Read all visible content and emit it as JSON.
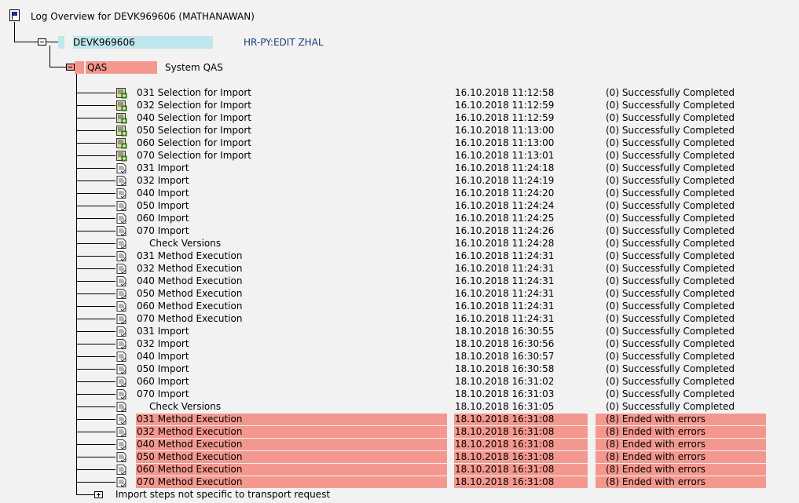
{
  "tree": {
    "root_title": "Log Overview for DEVK969606 (MATHANAWAN)",
    "system_node": {
      "label": "DEVK969606",
      "description": "HR-PY:EDIT ZHAL"
    },
    "target_node": {
      "label": "QAS",
      "description": "System QAS"
    },
    "footer_node": "Import steps not specific to transport request"
  },
  "colors": {
    "error_highlight": "#f4988f",
    "system_highlight": "#bfe6ec",
    "link": "#1a3c7a"
  },
  "rows": [
    {
      "icon": "selection-icon",
      "step": "031 Selection for Import",
      "date": "16.10.2018 11:12:58",
      "status": "(0) Successfully Completed",
      "error": false,
      "indent": false
    },
    {
      "icon": "selection-icon",
      "step": "032 Selection for Import",
      "date": "16.10.2018 11:12:59",
      "status": "(0) Successfully Completed",
      "error": false,
      "indent": false
    },
    {
      "icon": "selection-icon",
      "step": "040 Selection for Import",
      "date": "16.10.2018 11:12:59",
      "status": "(0) Successfully Completed",
      "error": false,
      "indent": false
    },
    {
      "icon": "selection-icon",
      "step": "050 Selection for Import",
      "date": "16.10.2018 11:13:00",
      "status": "(0) Successfully Completed",
      "error": false,
      "indent": false
    },
    {
      "icon": "selection-icon",
      "step": "060 Selection for Import",
      "date": "16.10.2018 11:13:00",
      "status": "(0) Successfully Completed",
      "error": false,
      "indent": false
    },
    {
      "icon": "selection-icon",
      "step": "070 Selection for Import",
      "date": "16.10.2018 11:13:01",
      "status": "(0) Successfully Completed",
      "error": false,
      "indent": false
    },
    {
      "icon": "document-icon",
      "step": "031 Import",
      "date": "16.10.2018 11:24:18",
      "status": "(0) Successfully Completed",
      "error": false,
      "indent": false
    },
    {
      "icon": "document-icon",
      "step": "032 Import",
      "date": "16.10.2018 11:24:19",
      "status": "(0) Successfully Completed",
      "error": false,
      "indent": false
    },
    {
      "icon": "document-icon",
      "step": "040 Import",
      "date": "16.10.2018 11:24:20",
      "status": "(0) Successfully Completed",
      "error": false,
      "indent": false
    },
    {
      "icon": "document-icon",
      "step": "050 Import",
      "date": "16.10.2018 11:24:24",
      "status": "(0) Successfully Completed",
      "error": false,
      "indent": false
    },
    {
      "icon": "document-icon",
      "step": "060 Import",
      "date": "16.10.2018 11:24:25",
      "status": "(0) Successfully Completed",
      "error": false,
      "indent": false
    },
    {
      "icon": "document-icon",
      "step": "070 Import",
      "date": "16.10.2018 11:24:26",
      "status": "(0) Successfully Completed",
      "error": false,
      "indent": false
    },
    {
      "icon": "document-icon",
      "step": "Check Versions",
      "date": "16.10.2018 11:24:28",
      "status": "(0) Successfully Completed",
      "error": false,
      "indent": true
    },
    {
      "icon": "document-icon",
      "step": "031 Method Execution",
      "date": "16.10.2018 11:24:31",
      "status": "(0) Successfully Completed",
      "error": false,
      "indent": false
    },
    {
      "icon": "document-icon",
      "step": "032 Method Execution",
      "date": "16.10.2018 11:24:31",
      "status": "(0) Successfully Completed",
      "error": false,
      "indent": false
    },
    {
      "icon": "document-icon",
      "step": "040 Method Execution",
      "date": "16.10.2018 11:24:31",
      "status": "(0) Successfully Completed",
      "error": false,
      "indent": false
    },
    {
      "icon": "document-icon",
      "step": "050 Method Execution",
      "date": "16.10.2018 11:24:31",
      "status": "(0) Successfully Completed",
      "error": false,
      "indent": false
    },
    {
      "icon": "document-icon",
      "step": "060 Method Execution",
      "date": "16.10.2018 11:24:31",
      "status": "(0) Successfully Completed",
      "error": false,
      "indent": false
    },
    {
      "icon": "document-icon",
      "step": "070 Method Execution",
      "date": "16.10.2018 11:24:31",
      "status": "(0) Successfully Completed",
      "error": false,
      "indent": false
    },
    {
      "icon": "document-icon",
      "step": "031 Import",
      "date": "18.10.2018 16:30:55",
      "status": "(0) Successfully Completed",
      "error": false,
      "indent": false
    },
    {
      "icon": "document-icon",
      "step": "032 Import",
      "date": "18.10.2018 16:30:56",
      "status": "(0) Successfully Completed",
      "error": false,
      "indent": false
    },
    {
      "icon": "document-icon",
      "step": "040 Import",
      "date": "18.10.2018 16:30:57",
      "status": "(0) Successfully Completed",
      "error": false,
      "indent": false
    },
    {
      "icon": "document-icon",
      "step": "050 Import",
      "date": "18.10.2018 16:30:58",
      "status": "(0) Successfully Completed",
      "error": false,
      "indent": false
    },
    {
      "icon": "document-icon",
      "step": "060 Import",
      "date": "18.10.2018 16:31:02",
      "status": "(0) Successfully Completed",
      "error": false,
      "indent": false
    },
    {
      "icon": "document-icon",
      "step": "070 Import",
      "date": "18.10.2018 16:31:03",
      "status": "(0) Successfully Completed",
      "error": false,
      "indent": false
    },
    {
      "icon": "document-icon",
      "step": "Check Versions",
      "date": "18.10.2018 16:31:05",
      "status": "(0) Successfully Completed",
      "error": false,
      "indent": true
    },
    {
      "icon": "document-icon",
      "step": "031 Method Execution",
      "date": "18.10.2018 16:31:08",
      "status": "(8) Ended with errors",
      "error": true,
      "indent": false
    },
    {
      "icon": "document-icon",
      "step": "032 Method Execution",
      "date": "18.10.2018 16:31:08",
      "status": "(8) Ended with errors",
      "error": true,
      "indent": false
    },
    {
      "icon": "document-icon",
      "step": "040 Method Execution",
      "date": "18.10.2018 16:31:08",
      "status": "(8) Ended with errors",
      "error": true,
      "indent": false
    },
    {
      "icon": "document-icon",
      "step": "050 Method Execution",
      "date": "18.10.2018 16:31:08",
      "status": "(8) Ended with errors",
      "error": true,
      "indent": false
    },
    {
      "icon": "document-icon",
      "step": "060 Method Execution",
      "date": "18.10.2018 16:31:08",
      "status": "(8) Ended with errors",
      "error": true,
      "indent": false
    },
    {
      "icon": "document-icon",
      "step": "070 Method Execution",
      "date": "18.10.2018 16:31:08",
      "status": "(8) Ended with errors",
      "error": true,
      "indent": false
    }
  ]
}
